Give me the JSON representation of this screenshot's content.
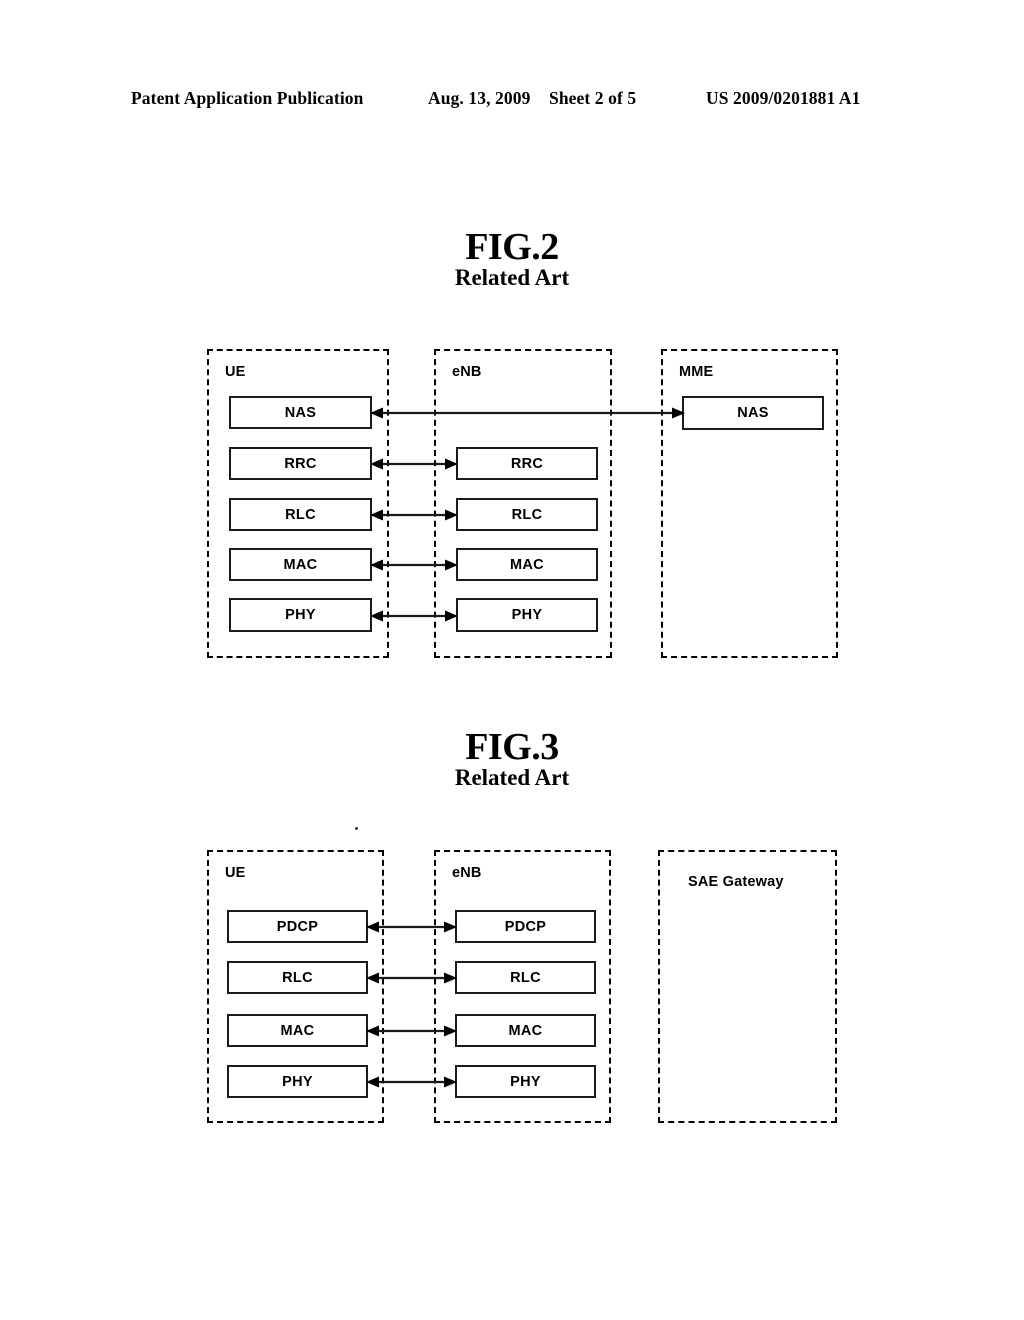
{
  "header": {
    "publication": "Patent Application Publication",
    "date": "Aug. 13, 2009",
    "sheet": "Sheet 2 of 5",
    "patent_number": "US 2009/0201881 A1"
  },
  "figures": [
    {
      "id": "fig2",
      "title": "FIG.2",
      "subtitle": "Related Art",
      "nodes": [
        {
          "name": "UE",
          "label": "UE",
          "layers": [
            "NAS",
            "RRC",
            "RLC",
            "MAC",
            "PHY"
          ]
        },
        {
          "name": "eNB",
          "label": "eNB",
          "layers": [
            "RRC",
            "RLC",
            "MAC",
            "PHY"
          ]
        },
        {
          "name": "MME",
          "label": "MME",
          "layers": [
            "NAS"
          ]
        }
      ],
      "connections": [
        {
          "from": "UE.NAS",
          "to": "MME.NAS",
          "type": "single-arrow-left",
          "label": ""
        },
        {
          "from": "UE.RRC",
          "to": "eNB.RRC",
          "type": "double-arrow",
          "label": ""
        },
        {
          "from": "UE.RLC",
          "to": "eNB.RLC",
          "type": "double-arrow",
          "label": ""
        },
        {
          "from": "UE.MAC",
          "to": "eNB.MAC",
          "type": "double-arrow",
          "label": ""
        },
        {
          "from": "UE.PHY",
          "to": "eNB.PHY",
          "type": "double-arrow",
          "label": ""
        }
      ]
    },
    {
      "id": "fig3",
      "title": "FIG.3",
      "subtitle": "Related Art",
      "nodes": [
        {
          "name": "UE",
          "label": "UE",
          "layers": [
            "PDCP",
            "RLC",
            "MAC",
            "PHY"
          ]
        },
        {
          "name": "eNB",
          "label": "eNB",
          "layers": [
            "PDCP",
            "RLC",
            "MAC",
            "PHY"
          ]
        },
        {
          "name": "SAE_Gateway",
          "label": "SAE Gateway",
          "layers": []
        }
      ],
      "connections": [
        {
          "from": "UE.PDCP",
          "to": "eNB.PDCP",
          "type": "double-arrow",
          "label": ""
        },
        {
          "from": "UE.RLC",
          "to": "eNB.RLC",
          "type": "double-arrow",
          "label": ""
        },
        {
          "from": "UE.MAC",
          "to": "eNB.MAC",
          "type": "double-arrow",
          "label": ""
        },
        {
          "from": "UE.PHY",
          "to": "eNB.PHY",
          "type": "double-arrow",
          "label": ""
        }
      ]
    }
  ],
  "colors": {
    "ink": "#000000",
    "box_border": "#1a1a1a",
    "paper": "#ffffff"
  }
}
